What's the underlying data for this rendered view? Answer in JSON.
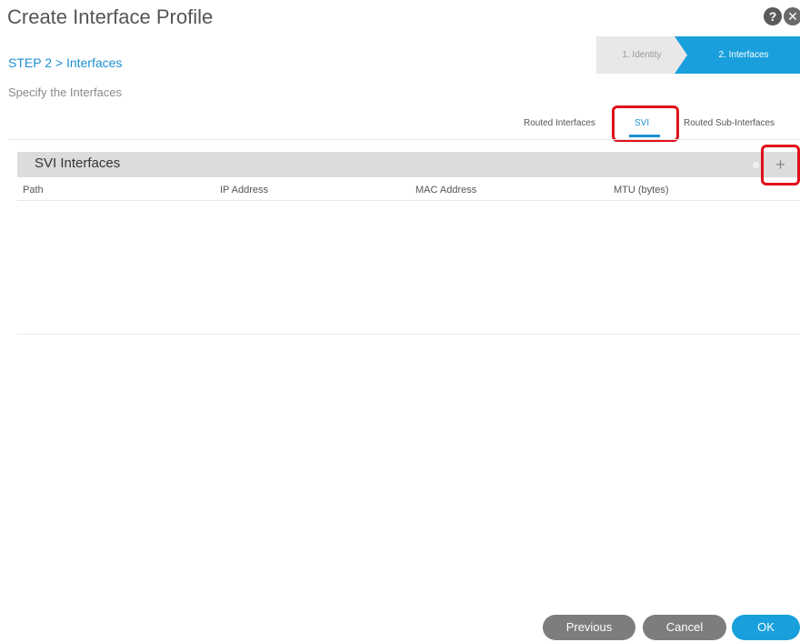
{
  "dialog": {
    "title": "Create Interface Profile",
    "help_icon": "?",
    "close_icon": "✕"
  },
  "step": {
    "label": "STEP 2 > Interfaces",
    "subtitle": "Specify the Interfaces"
  },
  "wizard": {
    "steps": [
      {
        "label": "1. Identity",
        "active": false
      },
      {
        "label": "2. Interfaces",
        "active": true
      }
    ]
  },
  "tabs": [
    {
      "label": "Routed Interfaces",
      "selected": false
    },
    {
      "label": "SVI",
      "selected": true
    },
    {
      "label": "Routed Sub-Interfaces",
      "selected": false
    }
  ],
  "table": {
    "title": "SVI Interfaces",
    "add_icon": "+",
    "columns": [
      "Path",
      "IP Address",
      "MAC Address",
      "MTU (bytes)"
    ],
    "rows": []
  },
  "footer": {
    "previous_label": "Previous",
    "cancel_label": "Cancel",
    "ok_label": "OK"
  },
  "colors": {
    "accent": "#19a0dc",
    "highlight": "#e0101a",
    "button_gray": "#7d7d7d"
  }
}
